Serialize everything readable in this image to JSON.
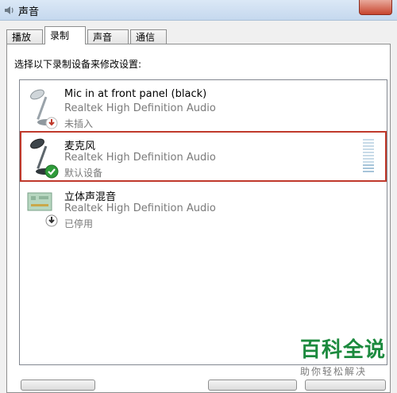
{
  "window": {
    "title": "声音",
    "icon": "speaker-icon"
  },
  "tabs": [
    {
      "label": "播放",
      "active": false
    },
    {
      "label": "录制",
      "active": true
    },
    {
      "label": "声音",
      "active": false
    },
    {
      "label": "通信",
      "active": false
    }
  ],
  "instruction": "选择以下录制设备来修改设置:",
  "devices": [
    {
      "name": "Mic in at front panel (black)",
      "driver": "Realtek High Definition Audio",
      "status": "未插入",
      "icon": "microphone-icon",
      "badge": "unplugged-badge-icon",
      "selected": false
    },
    {
      "name": "麦克风",
      "driver": "Realtek High Definition Audio",
      "status": "默认设备",
      "icon": "microphone-icon",
      "badge": "default-checkmark-icon",
      "selected": true
    },
    {
      "name": "立体声混音",
      "driver": "Realtek High Definition Audio",
      "status": "已停用",
      "icon": "sound-card-icon",
      "badge": "disabled-down-arrow-icon",
      "selected": false
    }
  ],
  "watermark": {
    "main": "百科全说",
    "sub": "助你轻松解决"
  },
  "colors": {
    "selection_outline": "#c0392b",
    "check_green": "#2e9b3a",
    "watermark_green": "#1c8a3e"
  }
}
